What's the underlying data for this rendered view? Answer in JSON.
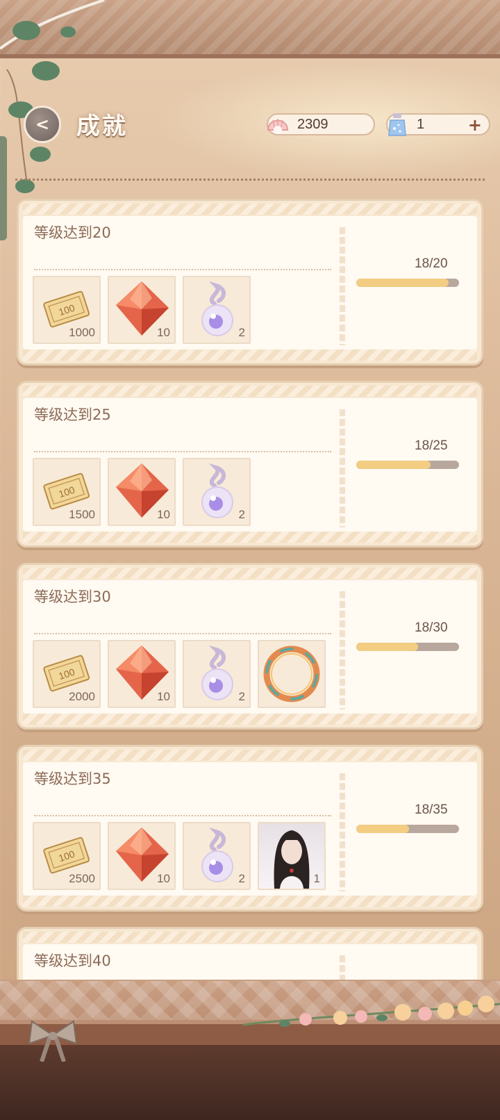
{
  "header": {
    "title": "成就",
    "currencies": [
      {
        "icon": "pearl-shell-icon",
        "value": "2309",
        "has_plus": false
      },
      {
        "icon": "star-bottle-icon",
        "value": "1",
        "has_plus": true,
        "plus_label": "+"
      }
    ]
  },
  "achievements": [
    {
      "title": "等级达到20",
      "progress_text": "18/20",
      "progress": 0.9,
      "rewards": [
        {
          "icon": "ticket-100-icon",
          "qty": "1000"
        },
        {
          "icon": "red-crystal-icon",
          "qty": "10"
        },
        {
          "icon": "pearl-vial-icon",
          "qty": "2"
        }
      ]
    },
    {
      "title": "等级达到25",
      "progress_text": "18/25",
      "progress": 0.72,
      "rewards": [
        {
          "icon": "ticket-100-icon",
          "qty": "1500"
        },
        {
          "icon": "red-crystal-icon",
          "qty": "10"
        },
        {
          "icon": "pearl-vial-icon",
          "qty": "2"
        }
      ]
    },
    {
      "title": "等级达到30",
      "progress_text": "18/30",
      "progress": 0.6,
      "rewards": [
        {
          "icon": "ticket-100-icon",
          "qty": "2000"
        },
        {
          "icon": "red-crystal-icon",
          "qty": "10"
        },
        {
          "icon": "pearl-vial-icon",
          "qty": "2"
        },
        {
          "icon": "avatar-frame-ring-icon",
          "qty": ""
        }
      ]
    },
    {
      "title": "等级达到35",
      "progress_text": "18/35",
      "progress": 0.514,
      "rewards": [
        {
          "icon": "ticket-100-icon",
          "qty": "2500"
        },
        {
          "icon": "red-crystal-icon",
          "qty": "10"
        },
        {
          "icon": "pearl-vial-icon",
          "qty": "2"
        },
        {
          "icon": "character-portrait-icon",
          "qty": "1"
        }
      ]
    },
    {
      "title": "等级达到40",
      "progress_text": "",
      "progress": null,
      "rewards": []
    }
  ]
}
